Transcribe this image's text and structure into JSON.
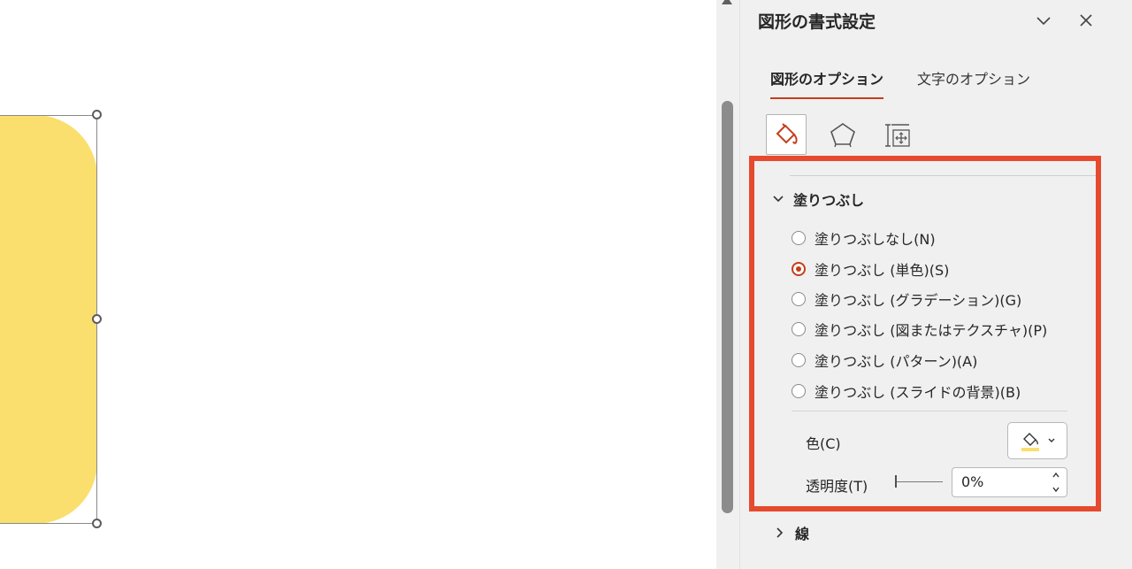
{
  "pane": {
    "title": "図形の書式設定",
    "tabs": [
      {
        "label": "図形のオプション",
        "active": true
      },
      {
        "label": "文字のオプション",
        "active": false
      }
    ],
    "icons": [
      "fill-and-line-icon",
      "effects-pentagon-icon",
      "size-properties-icon"
    ]
  },
  "fill": {
    "section_label": "塗りつぶし",
    "options": [
      {
        "label": "塗りつぶしなし(N)",
        "checked": false
      },
      {
        "label": "塗りつぶし (単色)(S)",
        "checked": true
      },
      {
        "label": "塗りつぶし (グラデーション)(G)",
        "checked": false
      },
      {
        "label": "塗りつぶし (図またはテクスチャ)(P)",
        "checked": false
      },
      {
        "label": "塗りつぶし (パターン)(A)",
        "checked": false
      },
      {
        "label": "塗りつぶし (スライドの背景)(B)",
        "checked": false
      }
    ],
    "color_label": "色(C)",
    "color_value": "#fadf6e",
    "transparency_label": "透明度(T)",
    "transparency_value": "0%",
    "transparency_fraction": 0
  },
  "line": {
    "section_label": "線"
  },
  "colors": {
    "accent": "#c43e1c",
    "highlight": "#e64a2e",
    "shape_fill": "#fadf6e",
    "pane_bg": "#f0f0f0"
  }
}
